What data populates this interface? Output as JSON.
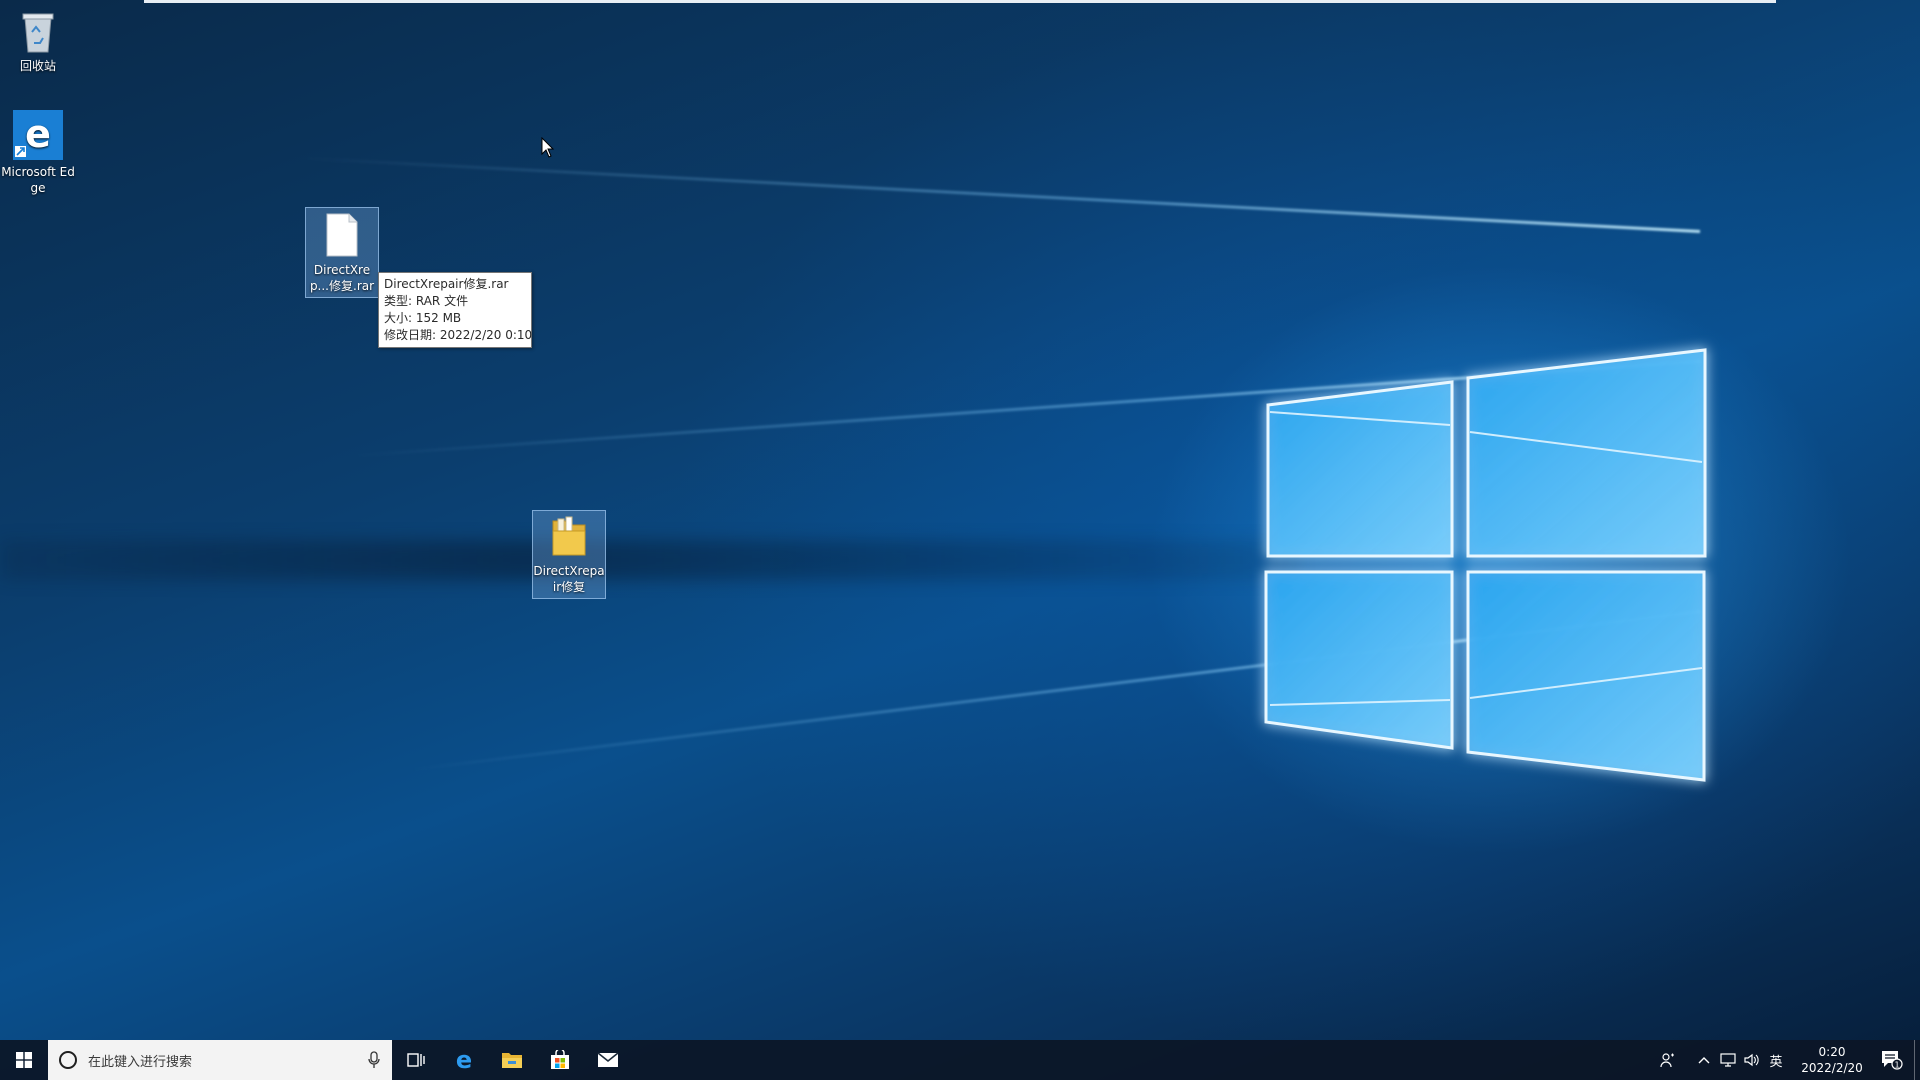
{
  "desktop": {
    "icons": [
      {
        "label": "回收站"
      },
      {
        "label": "Microsoft Edge"
      },
      {
        "label": "DirectXrep...修复.rar"
      },
      {
        "label": "DirectXrepair修复"
      }
    ],
    "tooltip": {
      "line1": "DirectXrepair修复.rar",
      "line2": "类型: RAR 文件",
      "line3": "大小: 152 MB",
      "line4": "修改日期: 2022/2/20 0:10"
    }
  },
  "taskbar": {
    "search_placeholder": "在此键入进行搜索",
    "pinned": [
      "task-view-icon",
      "edge-icon",
      "file-explorer-icon",
      "store-icon",
      "mail-icon"
    ],
    "ime": "英",
    "time": "0:20",
    "date": "2022/2/20",
    "notification_count": "1"
  },
  "colors": {
    "taskbar": "#0c1626",
    "accent": "#0078d7",
    "search_bg": "#f3f3f3"
  }
}
